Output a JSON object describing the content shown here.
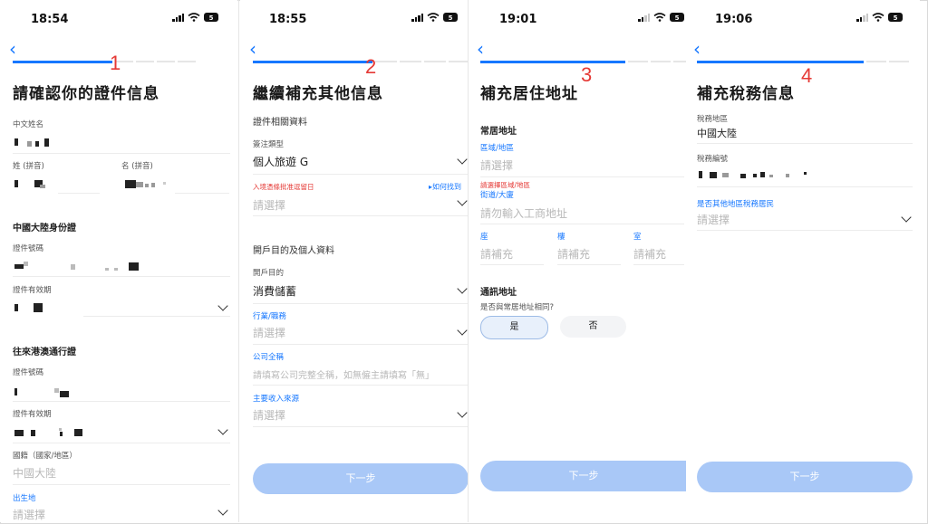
{
  "screens": [
    {
      "time": "18:54",
      "battery": "5",
      "step_number": "1",
      "title": "請確認你的證件信息",
      "chinese_name_label": "中文姓名",
      "surname_label": "姓 (拼音)",
      "given_name_label": "名 (拼音)",
      "mainland_id_section": "中國大陸身份證",
      "id_number_label": "證件號碼",
      "id_validity_label": "證件有效期",
      "hk_permit_section": "往來港澳通行證",
      "permit_number_label": "證件號碼",
      "permit_validity_label": "證件有效期",
      "nationality_label": "國籍（國家/地區）",
      "nationality_value": "中國大陸",
      "birthplace_label": "出生地",
      "birthplace_placeholder": "請選擇"
    },
    {
      "time": "18:55",
      "battery": "5",
      "step_number": "2",
      "title": "繼續補充其他信息",
      "doc_section": "證件相關資料",
      "visa_type_label": "簽注類型",
      "visa_type_value": "個人旅遊 G",
      "stay_date_label": "入境憑條批准逗留日",
      "how_to_find_link": "如何找到",
      "stay_date_placeholder": "請選擇",
      "purpose_section": "開戶目的及個人資料",
      "purpose_label": "開戶目的",
      "purpose_value": "消費儲蓄",
      "industry_label": "行業/職務",
      "industry_placeholder": "請選擇",
      "company_label": "公司全稱",
      "company_placeholder": "請填寫公司完整全稱，如無僱主請填寫「無」",
      "income_label": "主要收入來源",
      "income_placeholder": "請選擇",
      "next_button": "下一步"
    },
    {
      "time": "19:01",
      "battery": "5",
      "step_number": "3",
      "title": "補充居住地址",
      "residential_section": "常居地址",
      "region_label": "區域/地區",
      "region_placeholder": "請選擇",
      "region_error": "請選擇區域/地區",
      "street_label": "街道/大廈",
      "street_placeholder": "請勿輸入工商地址",
      "block_label": "座",
      "floor_label": "樓",
      "room_label": "室",
      "fill_placeholder": "請補充",
      "mailing_section": "通訊地址",
      "same_question": "是否與常居地址相同?",
      "yes_option": "是",
      "no_option": "否",
      "next_button": "下一步"
    },
    {
      "time": "19:06",
      "battery": "5",
      "step_number": "4",
      "title": "補充稅務信息",
      "tax_region_label": "稅務地區",
      "tax_region_value": "中國大陸",
      "tax_number_label": "稅務編號",
      "other_tax_label": "是否其他地區稅務居民",
      "other_tax_placeholder": "請選擇",
      "next_button": "下一步"
    }
  ],
  "colors": {
    "accent": "#1677ff",
    "disabled_button": "#a9c8f7",
    "step_number": "#e53935",
    "error": "#e53935"
  }
}
